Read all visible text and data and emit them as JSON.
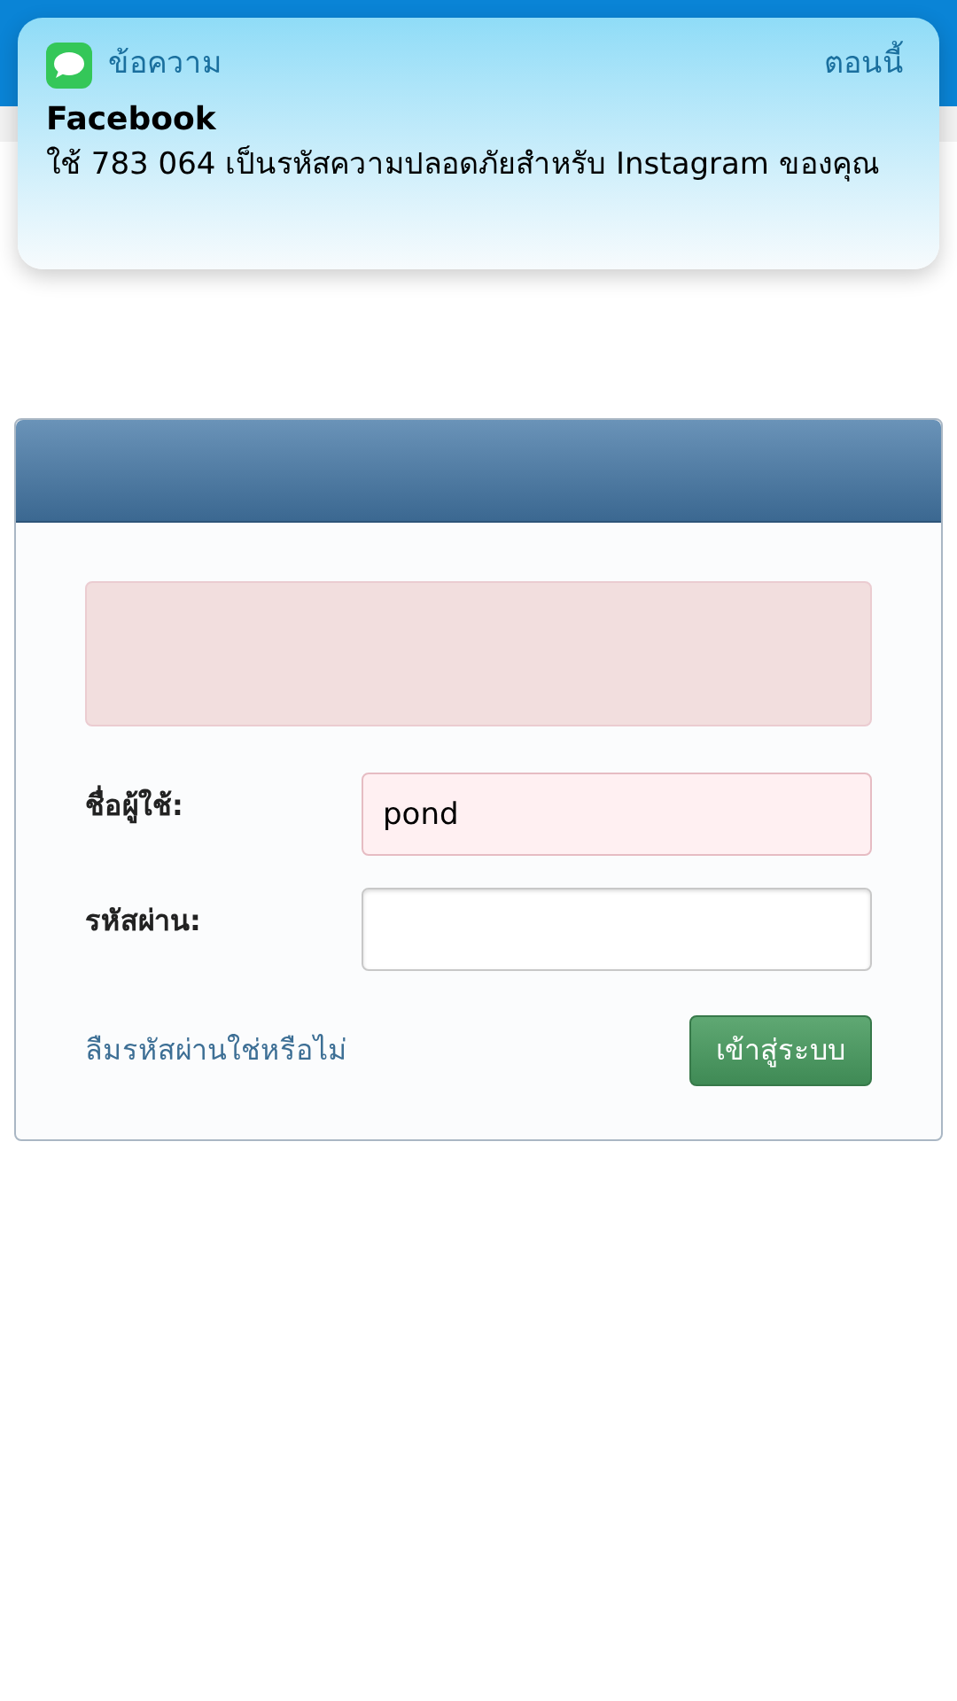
{
  "notification": {
    "app": "ข้อความ",
    "time": "ตอนนี้",
    "sender": "Facebook",
    "message": "ใช้ 783 064 เป็นรหัสความปลอดภัยสำหรับ Instagram ของคุณ"
  },
  "login": {
    "fields": [
      {
        "label": "ชื่อผู้ใช้:",
        "value": "pond",
        "invalid": true
      },
      {
        "label": "รหัสผ่าน:",
        "invalid": false
      }
    ],
    "forgot_link": "ลืมรหัสผ่านใช่หรือไม่",
    "submit": "เข้าสู่ระบบ"
  }
}
